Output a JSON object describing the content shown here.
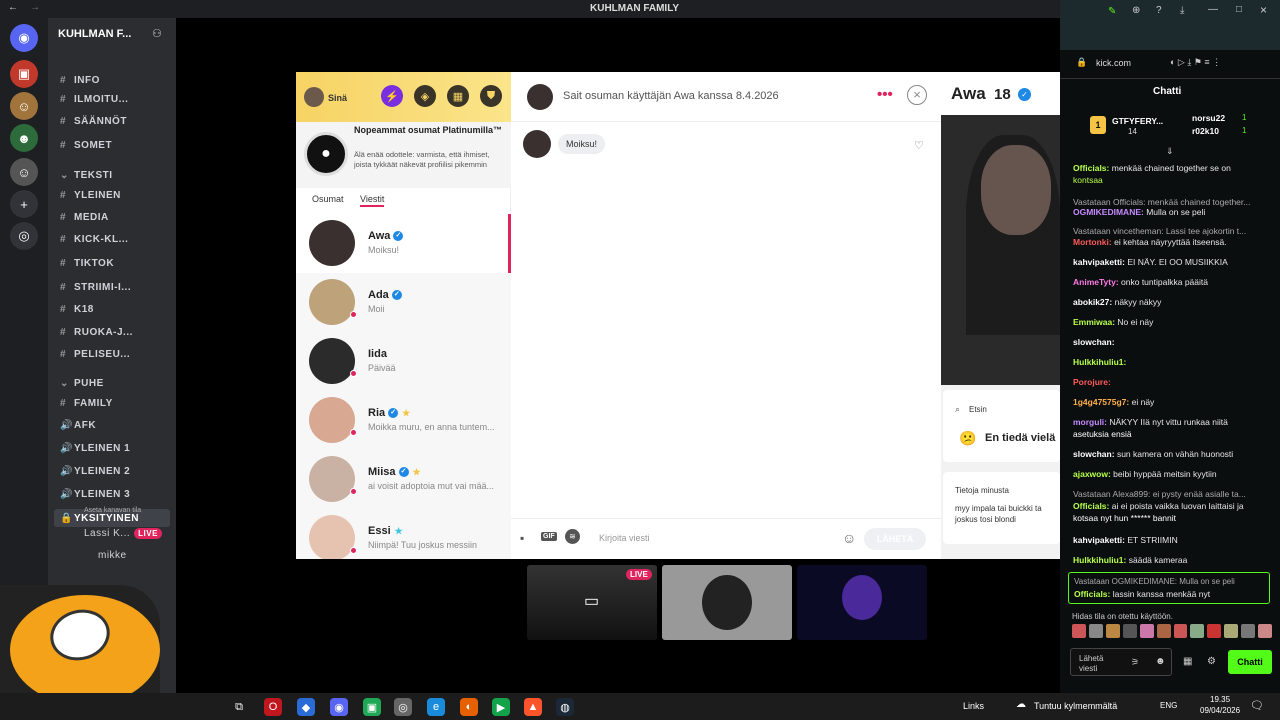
{
  "window": {
    "title": "KUHLMAN FAMILY"
  },
  "discord": {
    "server_name": "KUHLMAN F...",
    "channels": [
      {
        "label": "INFO",
        "icon": "hash"
      },
      {
        "label": "ILMOITU...",
        "icon": "hash"
      },
      {
        "label": "SÄÄNNÖT",
        "icon": "hash"
      },
      {
        "label": "SOMET",
        "icon": "hash"
      },
      {
        "label": "TEKSTI",
        "icon": "category"
      },
      {
        "label": "YLEINEN",
        "icon": "hash"
      },
      {
        "label": "MEDIA",
        "icon": "hash"
      },
      {
        "label": "KICK-KL...",
        "icon": "hash"
      },
      {
        "label": "TIKTOK",
        "icon": "hash"
      },
      {
        "label": "STRIIMI-I...",
        "icon": "hash"
      },
      {
        "label": "K18",
        "icon": "hash"
      },
      {
        "label": "RUOKA-J...",
        "icon": "hash"
      },
      {
        "label": "PELISEU...",
        "icon": "hash"
      },
      {
        "label": "PUHE",
        "icon": "category"
      },
      {
        "label": "FAMILY",
        "icon": "hash"
      },
      {
        "label": "AFK",
        "icon": "voice"
      },
      {
        "label": "YLEINEN 1",
        "icon": "voice"
      },
      {
        "label": "YLEINEN 2",
        "icon": "voice"
      },
      {
        "label": "YLEINEN 3",
        "icon": "voice"
      },
      {
        "label": "YKSITYINEN",
        "icon": "lock"
      }
    ],
    "private_sub": "Aseta kanavan tila",
    "voice_users": [
      {
        "name": "Lassi K...",
        "badge": "LIVE"
      },
      {
        "name": "mikke",
        "badge": ""
      }
    ]
  },
  "tinder": {
    "self_label": "Sinä",
    "promo": {
      "title": "Nopeammat osumat Platinumilla™",
      "body": "Älä enää odottele: varmista, että ihmiset, joista tykkäät näkevät profiilisi pikemmin"
    },
    "tabs": [
      "Osumat",
      "Viestit"
    ],
    "matches": [
      {
        "name": "Awa",
        "msg": "Moiksu!",
        "verified": true,
        "star": false
      },
      {
        "name": "Ada",
        "msg": "Moii",
        "verified": true,
        "star": false
      },
      {
        "name": "Iida",
        "msg": "Päivää",
        "verified": false,
        "star": false
      },
      {
        "name": "Ria",
        "msg": "Moikka muru, en anna tuntem...",
        "verified": true,
        "star": true
      },
      {
        "name": "Miisa",
        "msg": "ai voisit adoptoia mut vai mää...",
        "verified": true,
        "star": true
      },
      {
        "name": "Essi",
        "msg": "Niimpä! Tuu joskus messiin",
        "verified": false,
        "star": true
      }
    ],
    "chat": {
      "header": "Sait osuman käyttäjän Awa kanssa 8.4.2026",
      "message": "Moiksu!",
      "placeholder": "Kirjoita viesti",
      "gif_label": "GIF",
      "send_label": "LÄHETÄ"
    },
    "profile": {
      "name": "Awa",
      "age": "18",
      "looking_label": "Etsin",
      "looking_value": "En tiedä vielä",
      "about_label": "Tietoja minusta",
      "about_text": "myy impala tai buickki ta joskus tosi blondi"
    }
  },
  "browser": {
    "url": "kick.com"
  },
  "kick": {
    "title": "Chatti",
    "top_gifters": [
      {
        "name": "GTFYFERY...",
        "count": "14"
      },
      {
        "name": "norsu22",
        "count": "1"
      },
      {
        "name": "r02k10",
        "count": "1"
      }
    ],
    "messages": [
      {
        "user": "Officials:",
        "text": "menkää chained together se on",
        "color": "#b7ff4a"
      },
      {
        "user": "",
        "text": "kontsaa",
        "color": "#b7ff4a"
      },
      {
        "user": "",
        "text": "Vastataan Officials: menkää chained together...",
        "color": "#aaa"
      },
      {
        "user": "OGMIKEDIMANE:",
        "text": "Mulla on se peli",
        "color": "#c48aff"
      },
      {
        "user": "",
        "text": "Vastataan vincetheman: Lassi tee ajokortin t...",
        "color": "#aaa"
      },
      {
        "user": "Mortonki:",
        "text": "ei kehtaa näyryyttää itseensä.",
        "color": "#ff5a5a"
      },
      {
        "user": "kahvipaketti:",
        "text": "EI NÄY. EI OO MUSIIKKIA",
        "color": "#fff"
      },
      {
        "user": "AnimeTyty:",
        "text": "onko tuntipalkka pääitä",
        "color": "#ff7be6"
      },
      {
        "user": "abokik27:",
        "text": "näkyy näkyy",
        "color": "#fff"
      },
      {
        "user": "Emmiwaa:",
        "text": "No ei näy",
        "color": "#b7ff4a"
      },
      {
        "user": "slowchan:",
        "text": "",
        "color": "#fff"
      },
      {
        "user": "Hulkkihuliu1:",
        "text": "",
        "color": "#b7ff4a"
      },
      {
        "user": "Porojure:",
        "text": "",
        "color": "#ff5a5a"
      },
      {
        "user": "1g4g47575g7:",
        "text": "ei näy",
        "color": "#ffb04a"
      },
      {
        "user": "morguli:",
        "text": "NÄKYY IIä nyt vittu runkaa niitä",
        "color": "#c48aff"
      },
      {
        "user": "",
        "text": "asetuksia ensiä",
        "color": "#fff"
      },
      {
        "user": "slowchan:",
        "text": "sun kamera on vähän huonosti",
        "color": "#fff"
      },
      {
        "user": "ajaxwow:",
        "text": "beibi hyppää meitsin kyytiin",
        "color": "#b7ff4a"
      },
      {
        "user": "",
        "text": "Vastataan Alexa899: ei pysty enää asialle ta...",
        "color": "#aaa"
      },
      {
        "user": "Officials:",
        "text": "ai ei poista vaikka luovan laittaisi ja",
        "color": "#b7ff4a"
      },
      {
        "user": "",
        "text": "kotsaa nyt hun ****** bannit",
        "color": "#fff"
      },
      {
        "user": "kahvipaketti:",
        "text": "ET STRIIMIN",
        "color": "#fff"
      },
      {
        "user": "Hulkkihuliu1:",
        "text": "säädä kameraa",
        "color": "#b7ff4a"
      }
    ],
    "reply_preview": {
      "line1": "Vastataan OGMIKEDIMANE: Mulla on se peli",
      "user": "Officials:",
      "text": "lassin kanssa menkää nyt"
    },
    "notice": "Hidas tila on otettu käyttöön.",
    "input_placeholder": "Lähetä viesti",
    "chat_button": "Chatti"
  },
  "taskbar": {
    "links_label": "Links",
    "weather": "Tuntuu kylmemmältä",
    "lang": "ENG",
    "time": "19.35",
    "date": "09/04/2026"
  },
  "colors": {
    "tinder_gold": "#f6d364",
    "kick_green": "#53fc18",
    "live_red": "#e0245e"
  }
}
